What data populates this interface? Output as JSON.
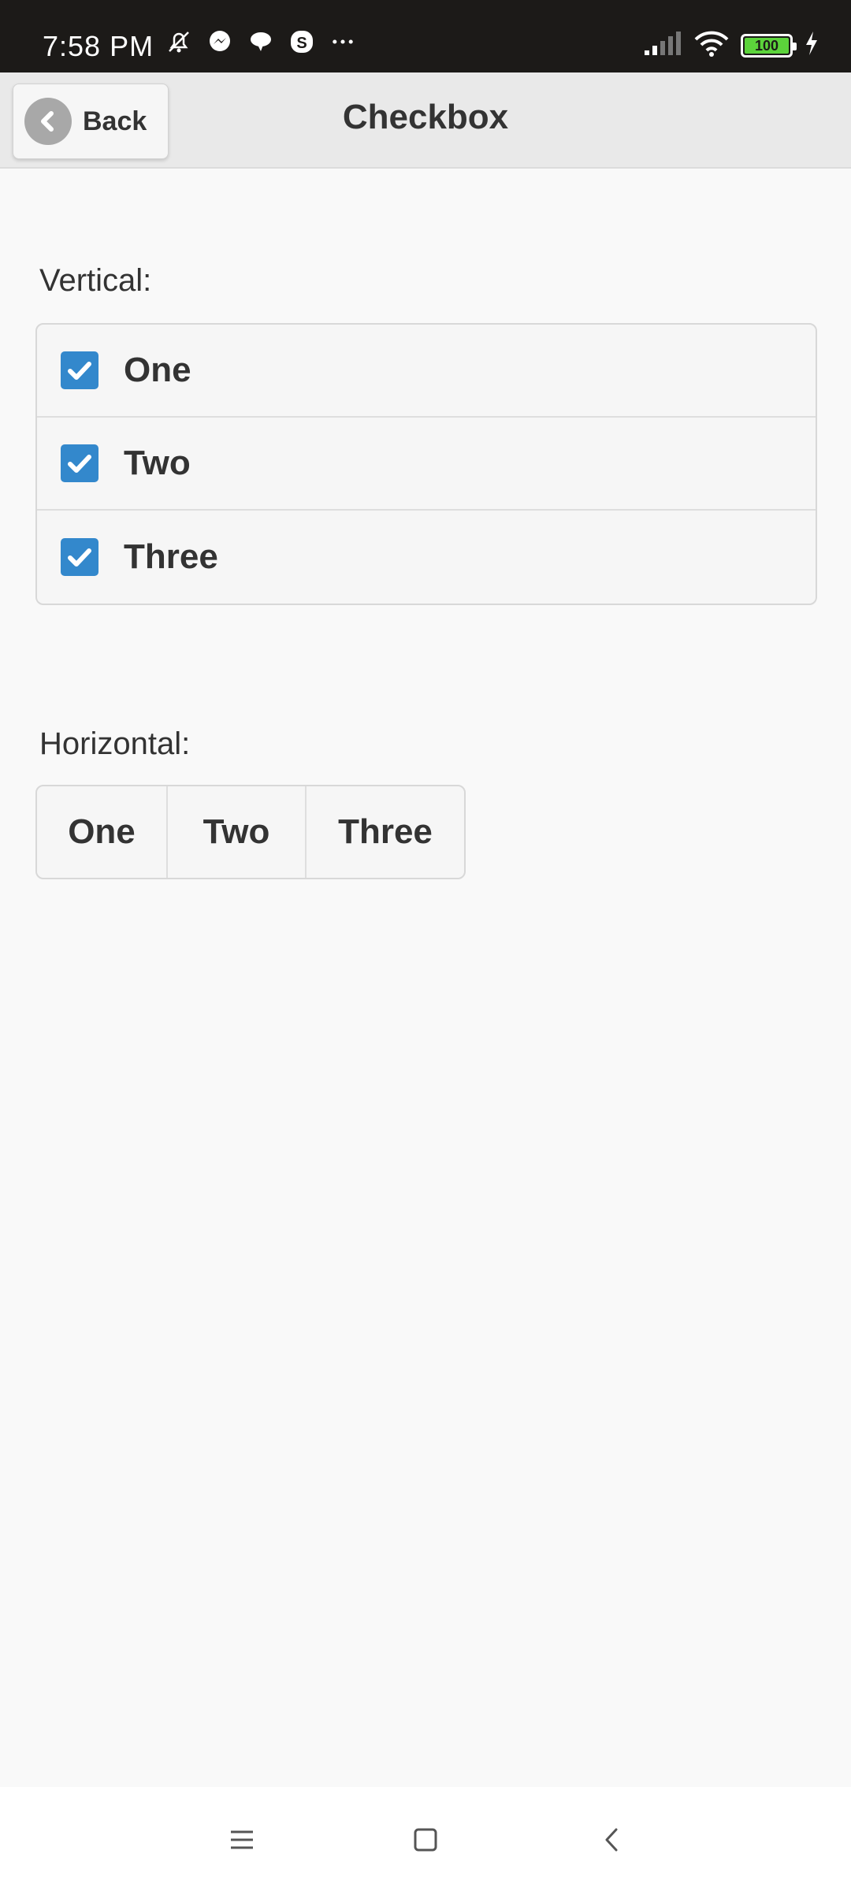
{
  "status_bar": {
    "time": "7:58",
    "ampm": "PM",
    "left_icons": [
      "mute-bell-icon",
      "messenger-icon",
      "chat-bubble-icon",
      "skype-icon",
      "more-dots-icon"
    ],
    "battery_level": "100",
    "battery_color": "#5cd33b"
  },
  "header": {
    "back_label": "Back",
    "title": "Checkbox"
  },
  "vertical": {
    "label": "Vertical:",
    "items": [
      {
        "label": "One",
        "checked": true
      },
      {
        "label": "Two",
        "checked": true
      },
      {
        "label": "Three",
        "checked": true
      }
    ]
  },
  "horizontal": {
    "label": "Horizontal:",
    "items": [
      {
        "label": "One",
        "checked": false
      },
      {
        "label": "Two",
        "checked": false
      },
      {
        "label": "Three",
        "checked": false
      }
    ]
  },
  "colors": {
    "checkbox_accent": "#3388cc"
  }
}
